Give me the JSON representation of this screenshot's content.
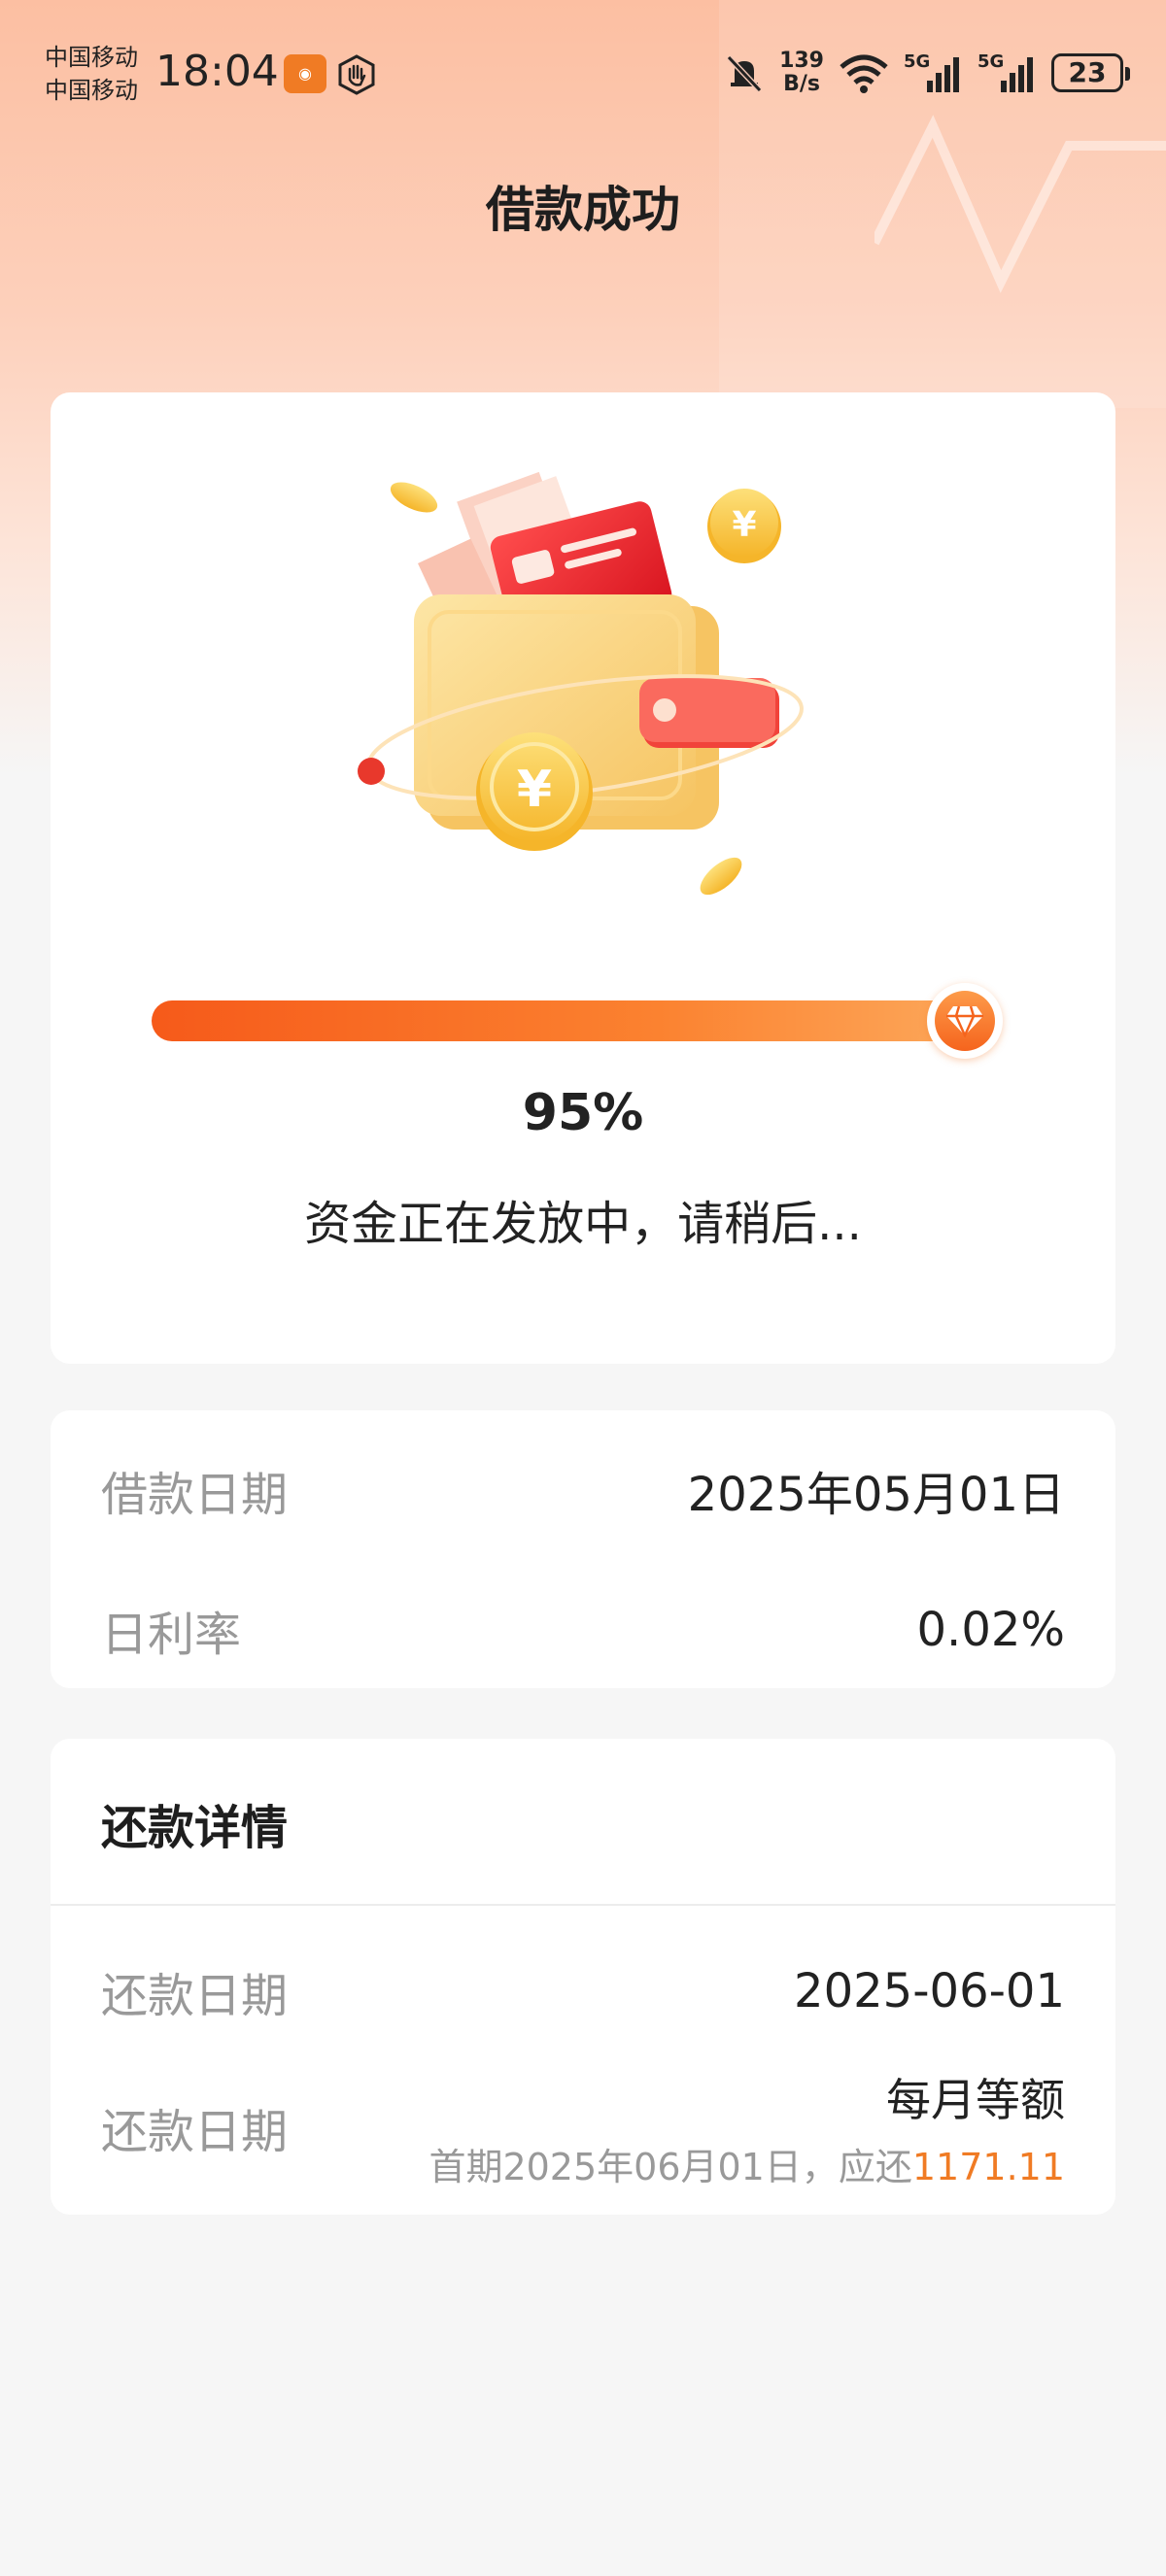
{
  "status_bar": {
    "carrier_1": "中国移动",
    "carrier_2": "中国移动",
    "time": "18:04",
    "net_speed_value": "139",
    "net_speed_unit": "B/s",
    "signal_1": "5G",
    "signal_2": "5G",
    "battery": "23"
  },
  "header": {
    "title": "借款成功"
  },
  "progress": {
    "percent": 0.95,
    "percent_label": "95%",
    "message": "资金正在发放中，请稍后..."
  },
  "loan_info": {
    "rows": [
      {
        "label": "借款日期",
        "value": "2025年05月01日"
      },
      {
        "label": "日利率",
        "value": "0.02%"
      }
    ]
  },
  "repayment": {
    "title": "还款详情",
    "date_row": {
      "label": "还款日期",
      "value": "2025-06-01"
    },
    "plan_row": {
      "label": "还款日期",
      "method": "每月等额",
      "first_period_text": "首期2025年06月01日，应还",
      "first_period_amount": "1171.11"
    }
  },
  "colors": {
    "accent": "#f07b24",
    "progress_start": "#f65a1a",
    "progress_end": "#fdab5e",
    "label_gray": "#999999"
  },
  "icons": [
    "app-notification-icon",
    "hand-icon",
    "mute-bell-icon",
    "wifi-icon",
    "signal-icon",
    "battery-icon",
    "diamond-icon",
    "wallet-illustration"
  ]
}
